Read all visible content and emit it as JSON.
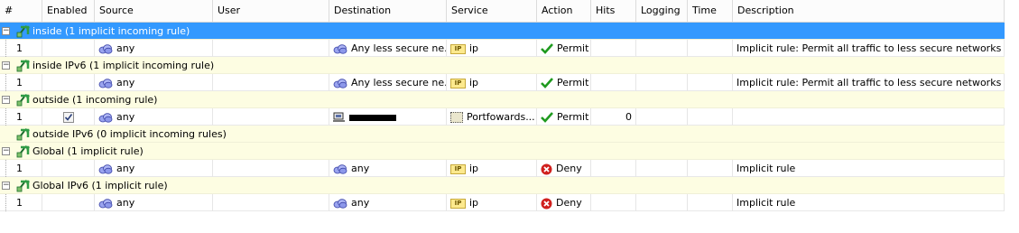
{
  "columns": [
    "#",
    "Enabled",
    "Source",
    "User",
    "Destination",
    "Service",
    "Action",
    "Hits",
    "Logging",
    "Time",
    "Description"
  ],
  "groups": [
    {
      "label": "inside (1 implicit incoming rule)",
      "selected": true,
      "expanded": true,
      "rules": [
        {
          "num": "1",
          "enabled": false,
          "source": "any",
          "destination": "Any less secure ne...",
          "dest_icon": "network-cloud-icon",
          "service": "ip",
          "service_icon": "ip-protocol-icon",
          "action": "Permit",
          "action_icon": "permit-check-icon",
          "hits": "",
          "description": "Implicit rule: Permit all traffic to less secure networks"
        }
      ]
    },
    {
      "label": "inside IPv6 (1 implicit incoming rule)",
      "selected": false,
      "expanded": true,
      "rules": [
        {
          "num": "1",
          "enabled": false,
          "source": "any",
          "destination": "Any less secure ne...",
          "dest_icon": "network-cloud-icon",
          "service": "ip",
          "service_icon": "ip-protocol-icon",
          "action": "Permit",
          "action_icon": "permit-check-icon",
          "hits": "",
          "description": "Implicit rule: Permit all traffic to less secure networks"
        }
      ]
    },
    {
      "label": "outside (1 incoming rule)",
      "selected": false,
      "expanded": true,
      "rules": [
        {
          "num": "1",
          "enabled": true,
          "source": "any",
          "destination": "",
          "dest_icon": "host-computer-icon",
          "service": "Portfowards...",
          "service_icon": "service-group-icon",
          "action": "Permit",
          "action_icon": "permit-check-icon",
          "hits": "0",
          "description": ""
        }
      ]
    },
    {
      "label": "outside IPv6 (0 implicit incoming rules)",
      "selected": false,
      "expanded": false,
      "rules": []
    },
    {
      "label": "Global (1 implicit rule)",
      "selected": false,
      "expanded": true,
      "rules": [
        {
          "num": "1",
          "enabled": false,
          "source": "any",
          "destination": "any",
          "dest_icon": "network-cloud-icon",
          "service": "ip",
          "service_icon": "ip-protocol-icon",
          "action": "Deny",
          "action_icon": "deny-x-icon",
          "hits": "",
          "description": "Implicit rule"
        }
      ]
    },
    {
      "label": "Global IPv6 (1 implicit rule)",
      "selected": false,
      "expanded": true,
      "rules": [
        {
          "num": "1",
          "enabled": false,
          "source": "any",
          "destination": "any",
          "dest_icon": "network-cloud-icon",
          "service": "ip",
          "service_icon": "ip-protocol-icon",
          "action": "Deny",
          "action_icon": "deny-x-icon",
          "hits": "",
          "description": "Implicit rule"
        }
      ]
    }
  ],
  "ip_badge": "IP",
  "colors": {
    "selected_row": "#3399ff",
    "group_row": "#fdfde2",
    "permit": "#1f9a1f",
    "deny": "#d0201e",
    "interface_icon": "#2f9c45"
  }
}
